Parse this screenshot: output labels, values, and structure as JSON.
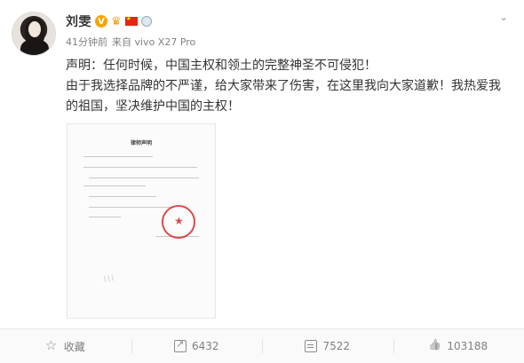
{
  "post": {
    "username": "刘雯",
    "meta": {
      "time": "41分钟前",
      "source": "来自 vivo X27 Pro"
    },
    "paragraphs": [
      "声明：任何时候，中国主权和领土的完整神圣不可侵犯！",
      "由于我选择品牌的不严谨，给大家带来了伤害，在这里我向大家道歉！我热爱我的祖国，坚决维护中国的主权！"
    ],
    "image": {
      "title": "律师声明"
    }
  },
  "actions": {
    "favorite_label": "收藏",
    "share_count": "6432",
    "comment_count": "7522",
    "like_count": "103188"
  },
  "icons": {
    "verified": "verified-v-icon",
    "member": "crown-icon",
    "flag": "china-flag-icon",
    "medal": "medal-icon",
    "more": "chevron-down-icon",
    "favorite": "star-icon",
    "share": "share-icon",
    "comment": "comment-icon",
    "like": "thumbs-up-icon"
  },
  "colors": {
    "verified": "#f7a500",
    "meta_text": "#808080",
    "body_text": "#333333",
    "seal_red": "#d12e2e"
  }
}
